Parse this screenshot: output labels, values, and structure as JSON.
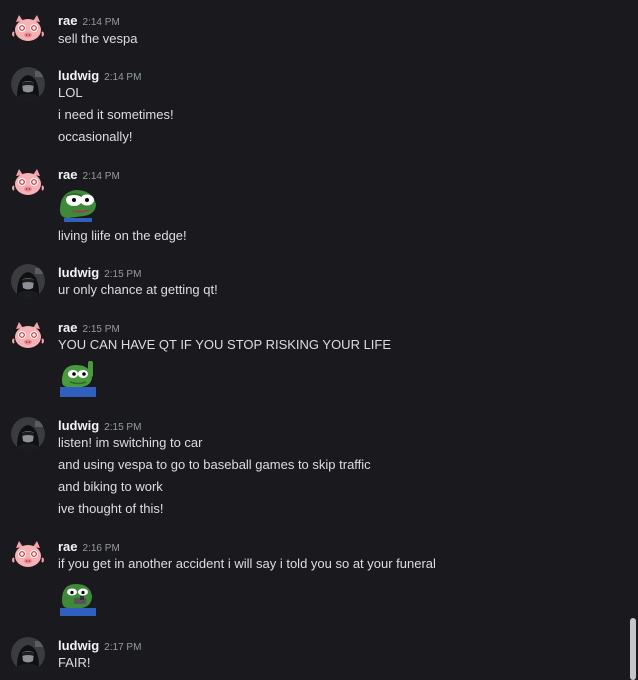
{
  "messages": [
    {
      "author": "rae",
      "time": "2:14 PM",
      "lines": [
        "sell the vespa"
      ]
    },
    {
      "author": "ludwig",
      "time": "2:14 PM",
      "lines": [
        "LOL",
        "i need it sometimes!",
        "occasionally!"
      ]
    },
    {
      "author": "rae",
      "time": "2:14 PM",
      "emote": "pepe-shocked-emote",
      "lines": [
        "living liife on the edge!"
      ]
    },
    {
      "author": "ludwig",
      "time": "2:15 PM",
      "lines": [
        "ur only chance at getting qt!"
      ]
    },
    {
      "author": "rae",
      "time": "2:15 PM",
      "lines": [
        "YOU CAN HAVE QT IF YOU STOP RISKING YOUR LIFE"
      ],
      "emote": "pepe-pointing-emote"
    },
    {
      "author": "ludwig",
      "time": "2:15 PM",
      "lines": [
        "listen! im switching to car",
        "and using vespa to go to baseball games to skip traffic",
        "and biking to work",
        "ive thought of this!"
      ]
    },
    {
      "author": "rae",
      "time": "2:16 PM",
      "lines": [
        "if you get in another accident i will say i told you so at your funeral"
      ],
      "emote": "pepe-gun-emote"
    },
    {
      "author": "ludwig",
      "time": "2:17 PM",
      "lines": [
        "FAIR!"
      ]
    }
  ],
  "colors": {
    "background": "#1a1a1e",
    "username": "#f2f3f5",
    "timestamp": "#949ba4",
    "text": "#dbdee1",
    "scrollbar": "#c6c6c8"
  }
}
